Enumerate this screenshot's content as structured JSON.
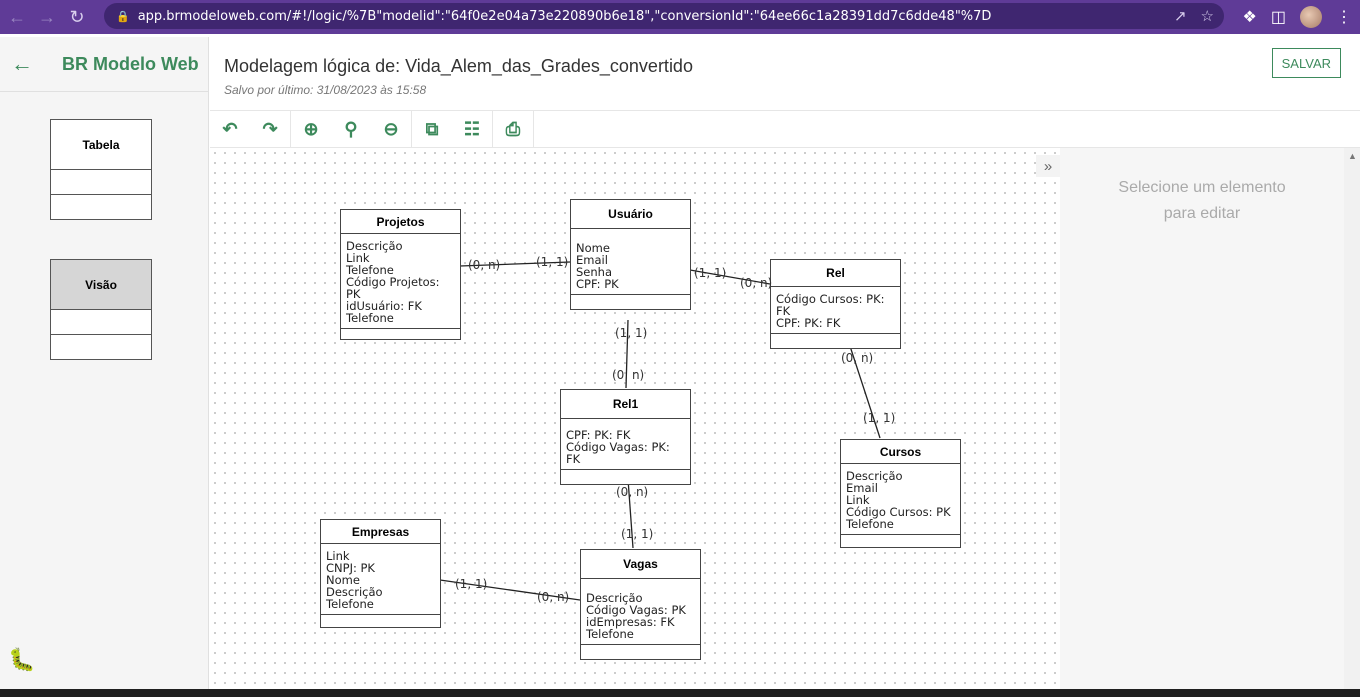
{
  "browser": {
    "url": "app.brmodeloweb.com/#!/logic/%7B\"modelid\":\"64f0e2e04a73e220890b6e18\",\"conversionId\":\"64ee66c1a28391dd7c6dde48\"%7D"
  },
  "sidebar": {
    "brand": "BR Modelo Web",
    "palette_table": "Tabela",
    "palette_view": "Visão"
  },
  "header": {
    "title": "Modelagem lógica de: Vida_Alem_das_Grades_convertido",
    "subtitle": "Salvo por último: 31/08/2023 às 15:58",
    "save_label": "SALVAR"
  },
  "toolbar": {
    "icons": [
      "undo-icon",
      "redo-icon",
      "zoom-in-icon",
      "zoom-reset-icon",
      "zoom-out-icon",
      "duplicate-icon",
      "database-icon",
      "print-icon"
    ]
  },
  "entities": {
    "projetos": {
      "name": "Projetos",
      "attrs": [
        "Descrição",
        "Link",
        "Telefone",
        "Código Projetos: PK",
        "idUsuário: FK",
        "Telefone"
      ]
    },
    "usuario": {
      "name": "Usuário",
      "attrs": [
        "Nome",
        "Email",
        "Senha",
        "CPF: PK"
      ]
    },
    "rel": {
      "name": "Rel",
      "attrs": [
        "Código Cursos: PK: FK",
        "CPF: PK: FK"
      ]
    },
    "rel1": {
      "name": "Rel1",
      "attrs": [
        "CPF: PK: FK",
        "Código Vagas: PK: FK"
      ]
    },
    "cursos": {
      "name": "Cursos",
      "attrs": [
        "Descrição",
        "Email",
        "Link",
        "Código Cursos: PK",
        "Telefone"
      ]
    },
    "empresas": {
      "name": "Empresas",
      "attrs": [
        "Link",
        "CNPJ: PK",
        "Nome",
        "Descrição",
        "Telefone"
      ]
    },
    "vagas": {
      "name": "Vagas",
      "attrs": [
        "Descrição",
        "Código Vagas: PK",
        "idEmpresas: FK",
        "Telefone"
      ]
    }
  },
  "cardinalities": {
    "c1": "(0, n)",
    "c2": "(1, 1)",
    "c3": "(1, 1)",
    "c4": "(0, n)",
    "c5": "(1, 1)",
    "c6": "(0, n)",
    "c7": "(0, n)",
    "c8": "(1, 1)",
    "c9": "(0, n)",
    "c10": "(1, 1)",
    "c11": "(1, 1)",
    "c12": "(0, n)"
  },
  "panel": {
    "empty_line1": "Selecione um elemento",
    "empty_line2": "para editar"
  }
}
